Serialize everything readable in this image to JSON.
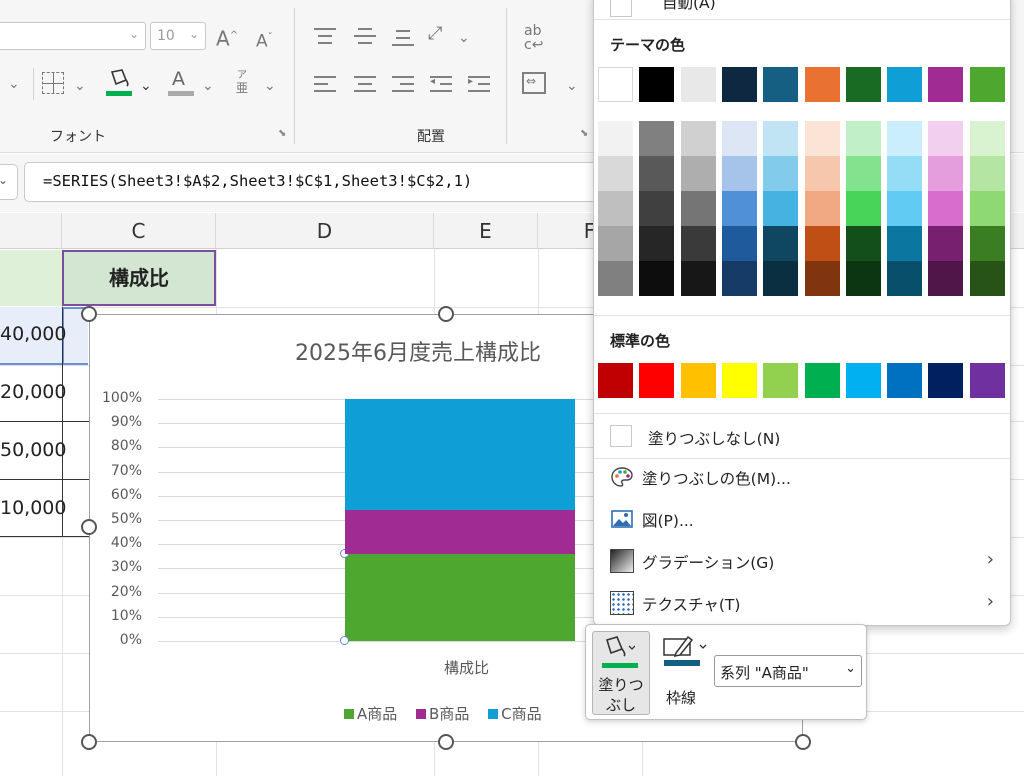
{
  "ribbon": {
    "font_size_value": "10",
    "font_group_label": "フォント",
    "align_group_label": "配置",
    "grow_font_icon": "A^",
    "shrink_font_icon": "A˅",
    "phonetic_icon": "亜",
    "fill_color_accent": "#00b050",
    "font_color_accent": "#aaaaaa"
  },
  "formula_bar": {
    "formula": "=SERIES(Sheet3!$A$2,Sheet3!$C$1,Sheet3!$C$2,1)"
  },
  "sheet": {
    "columns": [
      "C",
      "D",
      "E",
      "F"
    ],
    "header_cell": "構成比",
    "row_values": [
      "40,000",
      "20,000",
      "50,000",
      "10,000"
    ]
  },
  "chart_data": {
    "type": "bar",
    "stacked": "percent",
    "title": "2025年6月度売上構成比",
    "categories": [
      "構成比"
    ],
    "series": [
      {
        "name": "A商品",
        "values": [
          0.36
        ],
        "color": "#4ea72e"
      },
      {
        "name": "B商品",
        "values": [
          0.18
        ],
        "color": "#a02b93"
      },
      {
        "name": "C商品",
        "values": [
          0.46
        ],
        "color": "#0f9ed5"
      }
    ],
    "ylim": [
      0,
      1
    ],
    "yticks": [
      "0%",
      "10%",
      "20%",
      "30%",
      "40%",
      "50%",
      "60%",
      "70%",
      "80%",
      "90%",
      "100%"
    ],
    "grid": true,
    "legend": "bottom"
  },
  "dropdown": {
    "top_item_label": "自動(A)",
    "theme_label": "テーマの色",
    "theme_base": [
      "#ffffff",
      "#000000",
      "#e8e8e8",
      "#0e2841",
      "#156082",
      "#e97132",
      "#196b24",
      "#0f9ed5",
      "#a02b93",
      "#4ea72e"
    ],
    "theme_tints": [
      [
        "#f2f2f2",
        "#d9d9d9",
        "#bfbfbf",
        "#a6a6a6",
        "#808080"
      ],
      [
        "#808080",
        "#595959",
        "#404040",
        "#262626",
        "#0d0d0d"
      ],
      [
        "#d0d0d0",
        "#aeaeae",
        "#757575",
        "#3a3a3a",
        "#171717"
      ],
      [
        "#dce6f4",
        "#a6c3e9",
        "#4f90d6",
        "#1f5a9c",
        "#163b66"
      ],
      [
        "#c1e4f5",
        "#83cbeb",
        "#44b3e1",
        "#0f4761",
        "#0a2f40"
      ],
      [
        "#fbe3d6",
        "#f6c6ad",
        "#f1a983",
        "#c04f15",
        "#80350e"
      ],
      [
        "#c1f0c8",
        "#83e28e",
        "#47d459",
        "#124f1a",
        "#0c3511"
      ],
      [
        "#caeefb",
        "#95dcf7",
        "#61cbf3",
        "#0b76a0",
        "#074f6a"
      ],
      [
        "#f2cfee",
        "#e59edd",
        "#d86dcd",
        "#782070",
        "#501549"
      ],
      [
        "#d9f2d0",
        "#b4e5a2",
        "#8ed973",
        "#3b7d23",
        "#275317"
      ]
    ],
    "standard_label": "標準の色",
    "standard_colors": [
      "#c00000",
      "#ff0000",
      "#ffc000",
      "#ffff00",
      "#92d050",
      "#00b050",
      "#00b0f0",
      "#0070c0",
      "#002060",
      "#7030a0"
    ],
    "no_fill": "塗りつぶしなし(N)",
    "more_colors": "塗りつぶしの色(M)...",
    "picture": "図(P)...",
    "gradient": "グラデーション(G)",
    "texture": "テクスチャ(T)",
    "submenu_arrow": "›"
  },
  "mini_toolbar": {
    "fill_label_line1": "塗りつ",
    "fill_label_line2": "ぶし",
    "outline_label": "枠線",
    "series_select": "系列 \"A商品\""
  }
}
